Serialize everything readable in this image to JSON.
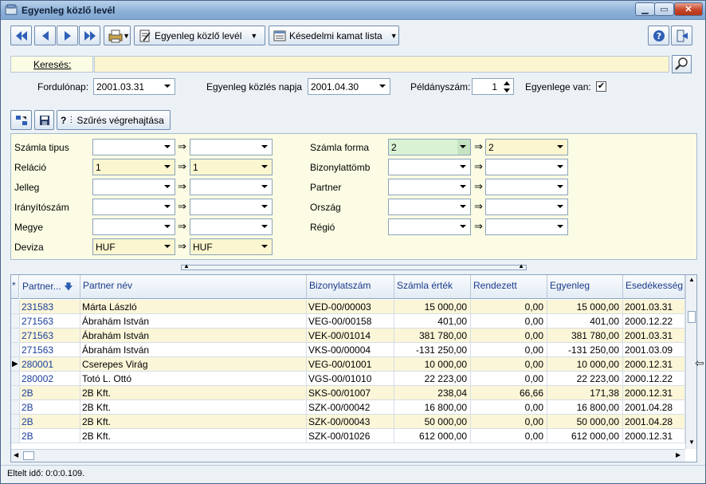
{
  "window": {
    "title": "Egyenleg közlő levél"
  },
  "toolbar": {
    "report_button": "Egyenleg közlő levél",
    "interest_button": "Késedelmi kamat lista"
  },
  "search": {
    "label": "Keresés:",
    "value": ""
  },
  "params": {
    "turning_day_label": "Fordulónap:",
    "turning_day_value": "2001.03.31",
    "notice_date_label": "Egyenleg közlés napja",
    "notice_date_value": "2001.04.30",
    "copies_label": "Példányszám:",
    "copies_value": "1",
    "has_balance_label": "Egyenlege van:",
    "has_balance_checked": "✔"
  },
  "filter_toolbar": {
    "run_filter_label": "Szűrés végrehajtása"
  },
  "filters": {
    "left": [
      {
        "label": "Számla tipus",
        "from": "",
        "to": ""
      },
      {
        "label": "Reláció",
        "from": "1",
        "to": "1"
      },
      {
        "label": "Jelleg",
        "from": "",
        "to": ""
      },
      {
        "label": "Irányítószám",
        "from": "",
        "to": ""
      },
      {
        "label": "Megye",
        "from": "",
        "to": ""
      },
      {
        "label": "Deviza",
        "from": "HUF",
        "to": "HUF"
      }
    ],
    "right": [
      {
        "label": "Számla forma",
        "from": "2",
        "to": "2"
      },
      {
        "label": "Bizonylattömb",
        "from": "",
        "to": ""
      },
      {
        "label": "Partner",
        "from": "",
        "to": ""
      },
      {
        "label": "Ország",
        "from": "",
        "to": ""
      },
      {
        "label": "Régió",
        "from": "",
        "to": ""
      }
    ],
    "arrow": "⇒"
  },
  "grid": {
    "marker_header": "*",
    "columns": [
      "Partner...",
      "Partner név",
      "Bizonylatszám",
      "Számla érték",
      "Rendezett",
      "Egyenleg",
      "Esedékesség"
    ],
    "current_row_marker": "▶",
    "rows": [
      [
        "231583",
        "Márta László",
        "VED-00/00003",
        "15 000,00",
        "0,00",
        "15 000,00",
        "2001.03.31"
      ],
      [
        "271563",
        "Ábrahám István",
        "VEG-00/00158",
        "401,00",
        "0,00",
        "401,00",
        "2000.12.22"
      ],
      [
        "271563",
        "Ábrahám István",
        "VEK-00/01014",
        "381 780,00",
        "0,00",
        "381 780,00",
        "2001.03.31"
      ],
      [
        "271563",
        "Ábrahám István",
        "VKS-00/00004",
        "-131 250,00",
        "0,00",
        "-131 250,00",
        "2001.03.09"
      ],
      [
        "280001",
        "Cserepes Virág",
        "VEG-00/01001",
        "10 000,00",
        "0,00",
        "10 000,00",
        "2000.12.31"
      ],
      [
        "280002",
        "Totó L. Ottó",
        "VGS-00/01010",
        "22 223,00",
        "0,00",
        "22 223,00",
        "2000.12.22"
      ],
      [
        "2B",
        "2B Kft.",
        "SKS-00/01007",
        "238,04",
        "66,66",
        "171,38",
        "2000.12.31"
      ],
      [
        "2B",
        "2B Kft.",
        "SZK-00/00042",
        "16 800,00",
        "0,00",
        "16 800,00",
        "2001.04.28"
      ],
      [
        "2B",
        "2B Kft.",
        "SZK-00/00043",
        "50 000,00",
        "0,00",
        "50 000,00",
        "2001.04.28"
      ],
      [
        "2B",
        "2B Kft.",
        "SZK-00/01026",
        "612 000,00",
        "0,00",
        "612 000,00",
        "2000.12.31"
      ]
    ]
  },
  "status": {
    "elapsed": "Eltelt idő: 0:0:0.109."
  },
  "colors": {
    "row_alt": "#fbf6d8",
    "row_plain": "#ffffff",
    "header_text": "#1a3a8a"
  }
}
